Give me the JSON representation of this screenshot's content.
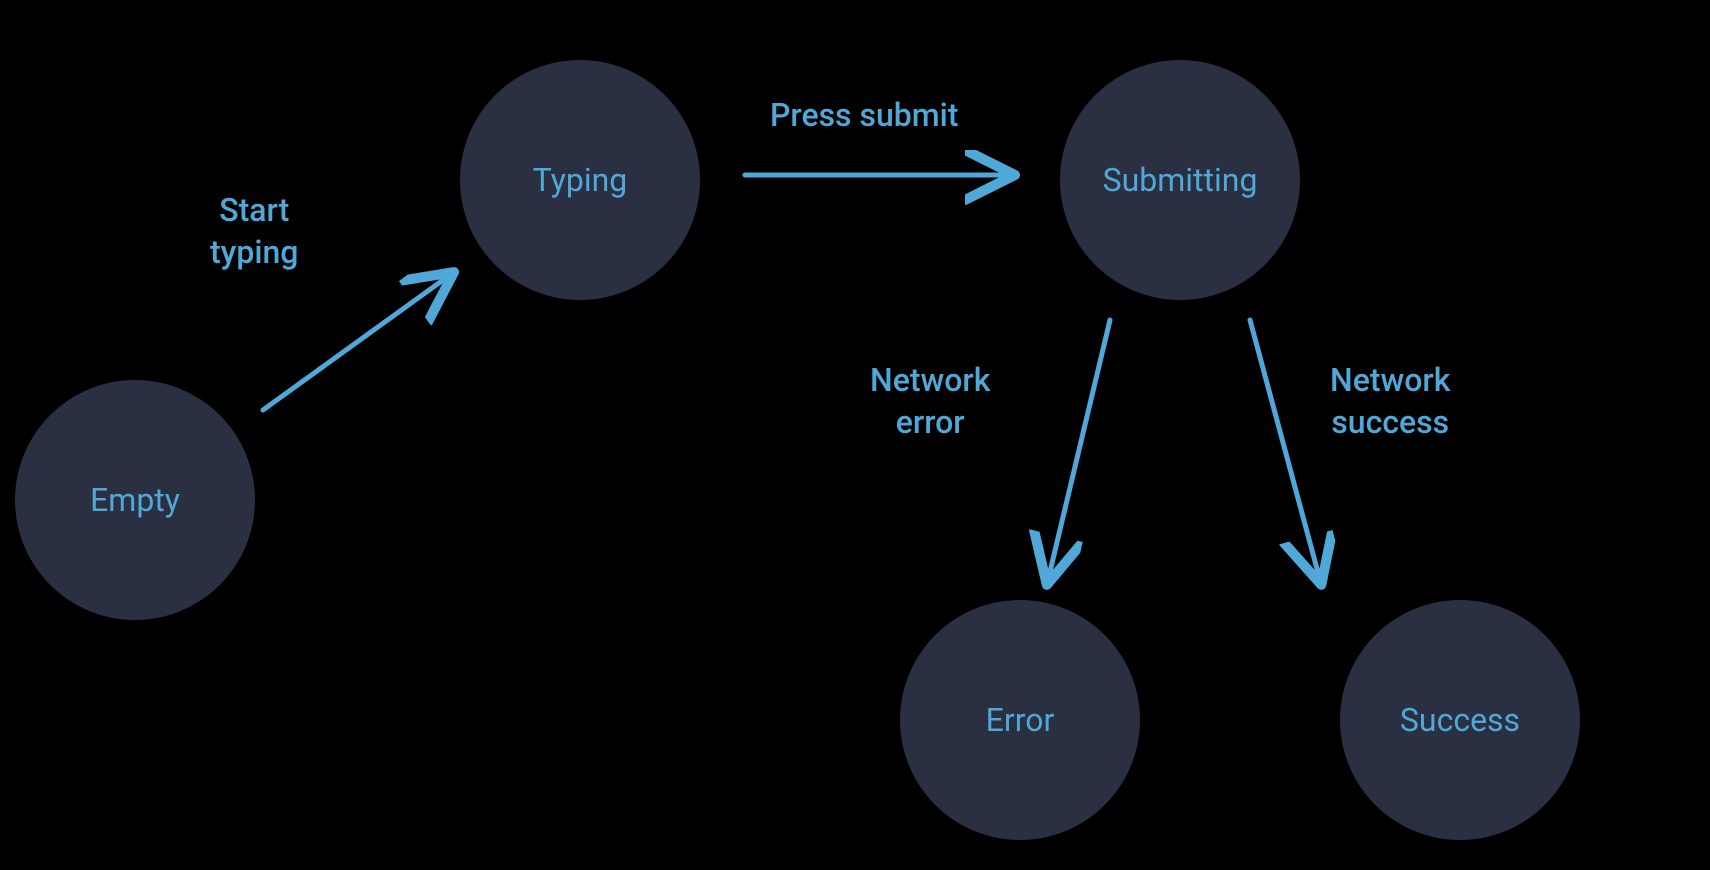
{
  "states": {
    "empty": {
      "label": "Empty"
    },
    "typing": {
      "label": "Typing"
    },
    "submitting": {
      "label": "Submitting"
    },
    "error": {
      "label": "Error"
    },
    "success": {
      "label": "Success"
    }
  },
  "transitions": {
    "start_typing": {
      "label": "Start\ntyping",
      "from": "empty",
      "to": "typing"
    },
    "press_submit": {
      "label": "Press submit",
      "from": "typing",
      "to": "submitting"
    },
    "network_error": {
      "label": "Network\nerror",
      "from": "submitting",
      "to": "error"
    },
    "network_success": {
      "label": "Network\nsuccess",
      "from": "submitting",
      "to": "success"
    }
  },
  "colors": {
    "node_bg": "#2a3042",
    "text": "#4fa8d8",
    "arrow": "#4fa8d8",
    "background": "#000000"
  }
}
